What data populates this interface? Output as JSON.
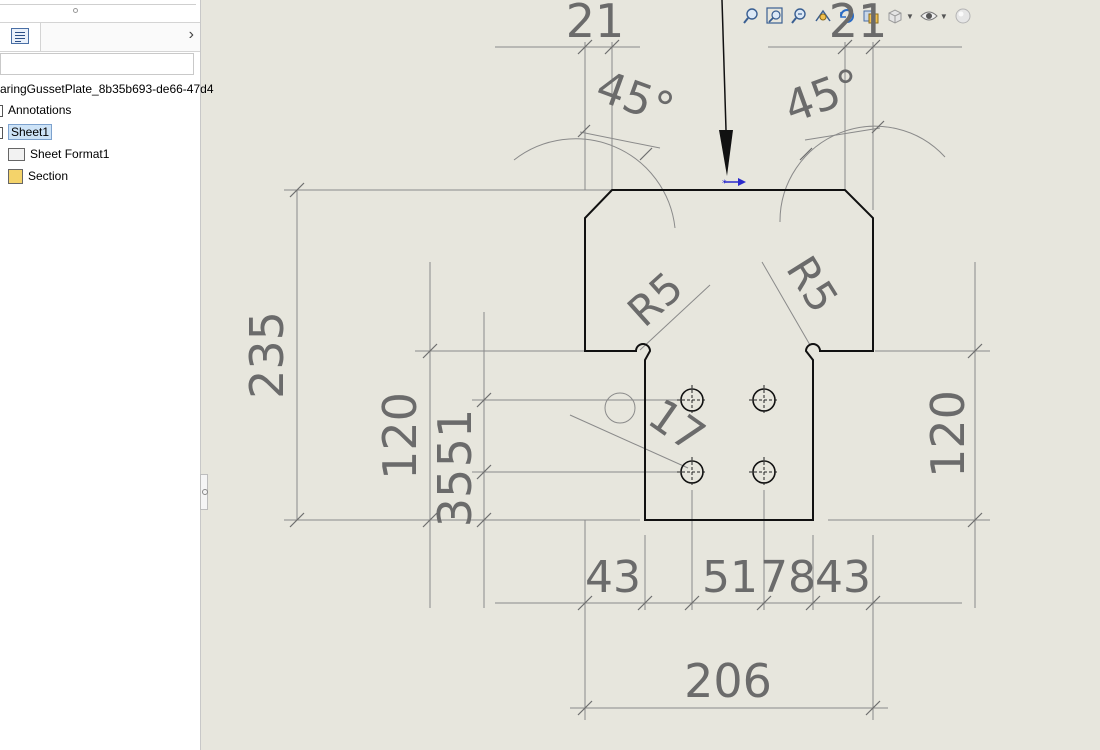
{
  "tree": {
    "root_label": "aringGussetPlate_8b35b693-de66-47d4",
    "items": [
      {
        "label": "Annotations"
      },
      {
        "label": "Sheet1"
      },
      {
        "label": "Sheet Format1"
      },
      {
        "label": "Section"
      }
    ],
    "filter_value": ""
  },
  "drawing": {
    "dims": {
      "top_left": "21",
      "top_right": "21",
      "angle_left": "45°",
      "angle_right": "45°",
      "radius_left": "R5",
      "radius_right": "R5",
      "height_total": "235",
      "height_left": "120",
      "height_right": "120",
      "vert_35": "35",
      "vert_51": "51",
      "hole_dia": "17",
      "bottom_43a": "43",
      "bottom_51": "51",
      "bottom_78": "78",
      "bottom_43b": "43",
      "width_total": "206"
    }
  },
  "icons": [
    "zoom-to-fit-icon",
    "zoom-to-area-icon",
    "zoom-in-out-icon",
    "previous-view-icon",
    "rotate-view-icon",
    "section-view-icon",
    "view-orientation-icon",
    "display-style-icon",
    "hide-show-icon",
    "appearance-icon"
  ]
}
